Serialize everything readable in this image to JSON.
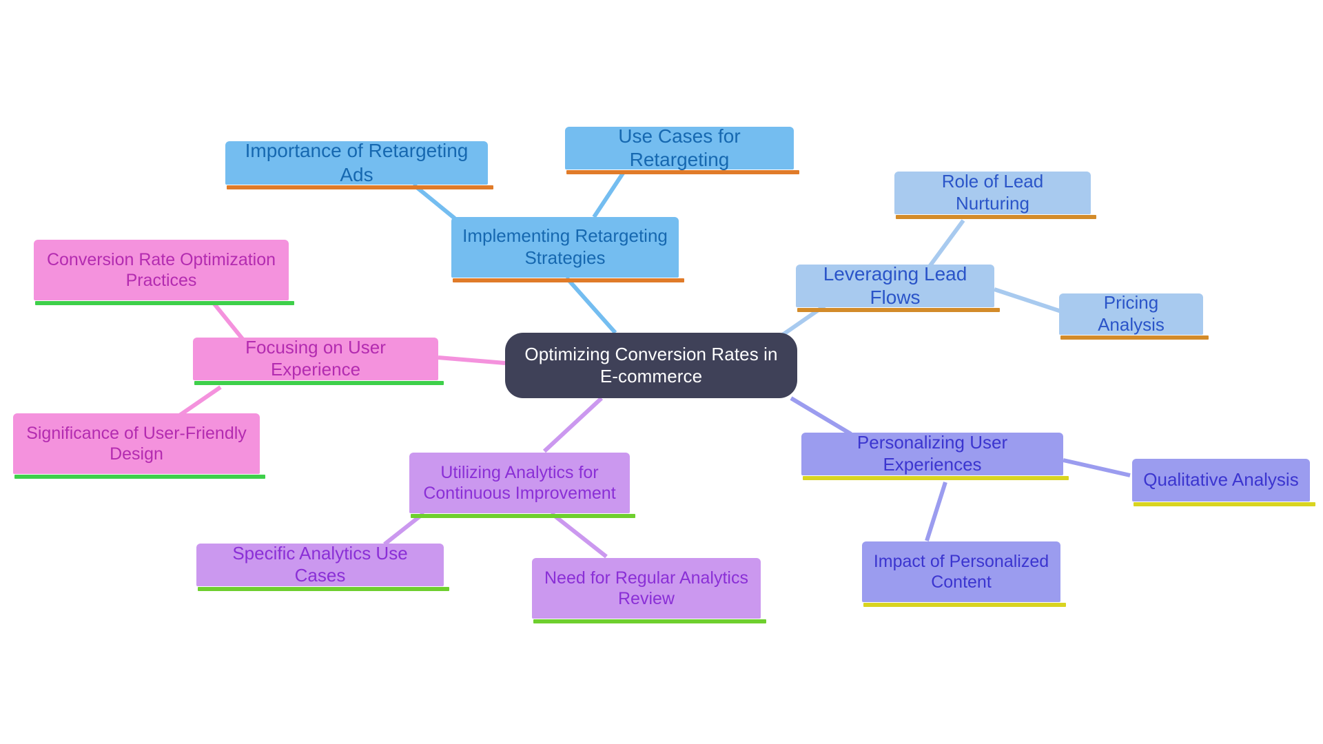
{
  "diagram": {
    "title": "Optimizing Conversion Rates in E-commerce",
    "type": "mind-map",
    "background": "#ffffff"
  },
  "root": {
    "label": "Optimizing Conversion Rates in E-commerce",
    "fill": "#3f4158",
    "text_color": "#ffffff"
  },
  "branches": [
    {
      "id": "retargeting",
      "label": "Implementing Retargeting Strategies",
      "fill": "#74bdf0",
      "text_color": "#1668b0",
      "accent": "#e07b29",
      "children": [
        {
          "label": "Importance of Retargeting Ads",
          "fill": "#74bdf0",
          "text_color": "#1668b0",
          "accent": "#e07b29"
        },
        {
          "label": "Use Cases for Retargeting",
          "fill": "#74bdf0",
          "text_color": "#1668b0",
          "accent": "#e07b29"
        }
      ]
    },
    {
      "id": "lead-flows",
      "label": "Leveraging Lead Flows",
      "fill": "#a8caef",
      "text_color": "#2a54c8",
      "accent": "#d38b2a",
      "children": [
        {
          "label": "Role of Lead Nurturing",
          "fill": "#a8caef",
          "text_color": "#2a54c8",
          "accent": "#d38b2a"
        },
        {
          "label": "Pricing Analysis",
          "fill": "#a8caef",
          "text_color": "#2a54c8",
          "accent": "#d38b2a"
        }
      ]
    },
    {
      "id": "user-experience",
      "label": "Focusing on User Experience",
      "fill": "#f492dd",
      "text_color": "#b32bb0",
      "accent": "#3ecf4a",
      "children": [
        {
          "label": "Conversion Rate Optimization Practices",
          "fill": "#f492dd",
          "text_color": "#b32bb0",
          "accent": "#3ecf4a"
        },
        {
          "label": "Significance of User-Friendly Design",
          "fill": "#f492dd",
          "text_color": "#b32bb0",
          "accent": "#3ecf4a"
        }
      ]
    },
    {
      "id": "analytics",
      "label": "Utilizing Analytics for Continuous Improvement",
      "fill": "#cb98ef",
      "text_color": "#8a2fd6",
      "accent": "#6ecf2e",
      "children": [
        {
          "label": "Specific Analytics Use Cases",
          "fill": "#cb98ef",
          "text_color": "#8a2fd6",
          "accent": "#6ecf2e"
        },
        {
          "label": "Need for Regular Analytics Review",
          "fill": "#cb98ef",
          "text_color": "#8a2fd6",
          "accent": "#6ecf2e"
        }
      ]
    },
    {
      "id": "personalization",
      "label": "Personalizing User Experiences",
      "fill": "#9b9cef",
      "text_color": "#3b35cf",
      "accent": "#d9d420",
      "children": [
        {
          "label": "Qualitative Analysis",
          "fill": "#9b9cef",
          "text_color": "#3b35cf",
          "accent": "#d9d420"
        },
        {
          "label": "Impact of Personalized Content",
          "fill": "#9b9cef",
          "text_color": "#3b35cf",
          "accent": "#d9d420"
        }
      ]
    }
  ],
  "edges": [
    {
      "from": "root",
      "to": "retargeting",
      "color": "#74bdf0"
    },
    {
      "from": "retargeting",
      "to": "Importance of Retargeting Ads",
      "color": "#74bdf0"
    },
    {
      "from": "retargeting",
      "to": "Use Cases for Retargeting",
      "color": "#74bdf0"
    },
    {
      "from": "root",
      "to": "lead-flows",
      "color": "#a8caef"
    },
    {
      "from": "lead-flows",
      "to": "Role of Lead Nurturing",
      "color": "#a8caef"
    },
    {
      "from": "lead-flows",
      "to": "Pricing Analysis",
      "color": "#a8caef"
    },
    {
      "from": "root",
      "to": "user-experience",
      "color": "#f492dd"
    },
    {
      "from": "user-experience",
      "to": "Conversion Rate Optimization Practices",
      "color": "#f492dd"
    },
    {
      "from": "user-experience",
      "to": "Significance of User-Friendly Design",
      "color": "#f492dd"
    },
    {
      "from": "root",
      "to": "analytics",
      "color": "#cb98ef"
    },
    {
      "from": "analytics",
      "to": "Specific Analytics Use Cases",
      "color": "#cb98ef"
    },
    {
      "from": "analytics",
      "to": "Need for Regular Analytics Review",
      "color": "#cb98ef"
    },
    {
      "from": "root",
      "to": "personalization",
      "color": "#9b9cef"
    },
    {
      "from": "personalization",
      "to": "Qualitative Analysis",
      "color": "#9b9cef"
    },
    {
      "from": "personalization",
      "to": "Impact of Personalized Content",
      "color": "#9b9cef"
    }
  ]
}
